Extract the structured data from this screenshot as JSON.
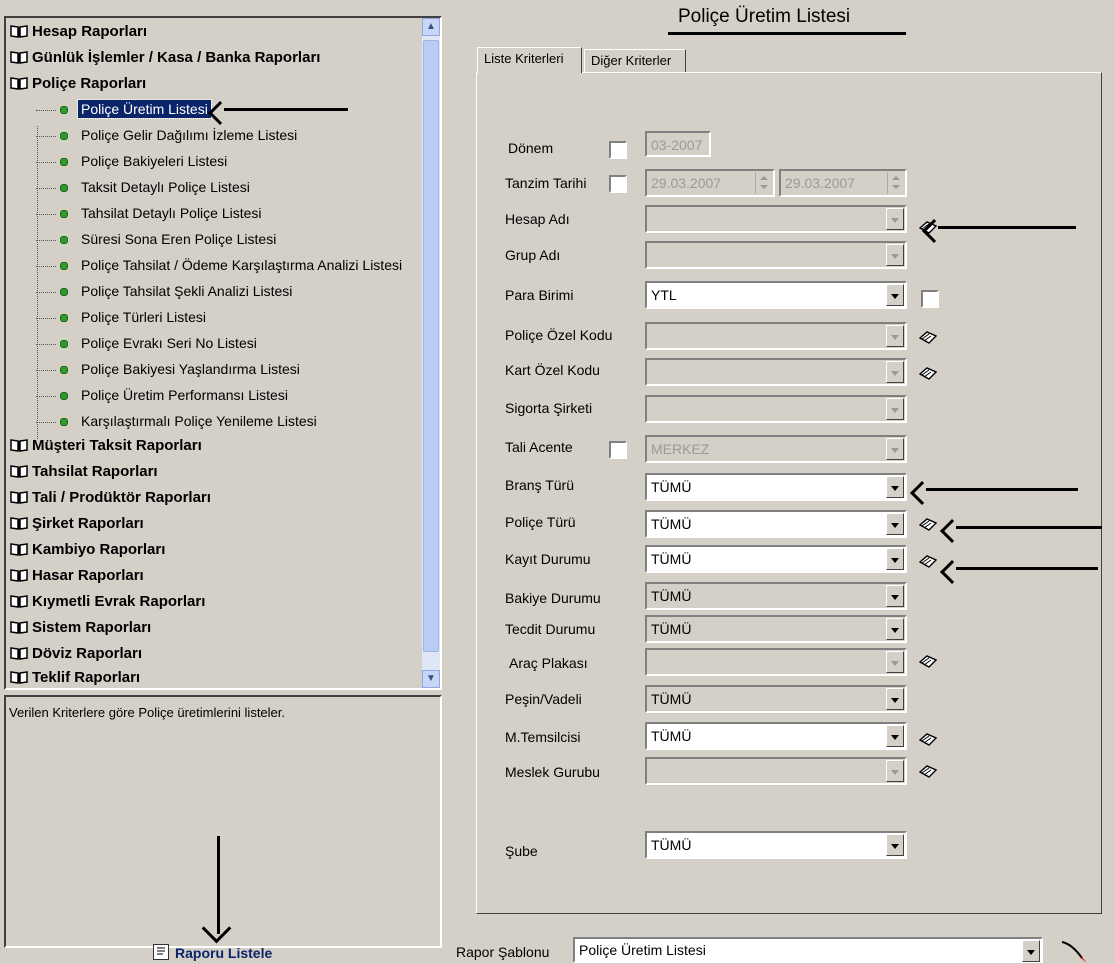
{
  "tree": {
    "groups_top": [
      {
        "label": "Hesap Raporları"
      },
      {
        "label": "Günlük İşlemler / Kasa / Banka Raporları"
      },
      {
        "label": "Poliçe Raporları"
      }
    ],
    "items": [
      {
        "label": "Poliçe Üretim Listesi",
        "selected": true
      },
      {
        "label": "Poliçe Gelir Dağılımı İzleme Listesi"
      },
      {
        "label": "Poliçe Bakiyeleri Listesi"
      },
      {
        "label": "Taksit Detaylı Poliçe Listesi"
      },
      {
        "label": "Tahsilat Detaylı Poliçe Listesi"
      },
      {
        "label": "Süresi Sona Eren Poliçe Listesi"
      },
      {
        "label": "Poliçe Tahsilat / Ödeme Karşılaştırma Analizi Listesi"
      },
      {
        "label": "Poliçe Tahsilat Şekli Analizi Listesi"
      },
      {
        "label": "Poliçe Türleri Listesi"
      },
      {
        "label": "Poliçe Evrakı Seri No Listesi"
      },
      {
        "label": "Poliçe Bakiyesi Yaşlandırma Listesi"
      },
      {
        "label": "Poliçe Üretim Performansı Listesi"
      },
      {
        "label": "Karşılaştırmalı Poliçe Yenileme Listesi"
      }
    ],
    "groups_bottom": [
      {
        "label": "Müşteri Taksit Raporları"
      },
      {
        "label": "Tahsilat Raporları"
      },
      {
        "label": "Tali / Prodüktör Raporları"
      },
      {
        "label": "Şirket Raporları"
      },
      {
        "label": "Kambiyo Raporları"
      },
      {
        "label": "Hasar Raporları"
      },
      {
        "label": "Kıymetli Evrak Raporları"
      },
      {
        "label": "Sistem Raporları"
      },
      {
        "label": "Döviz Raporları"
      },
      {
        "label": "Teklif Raporları"
      }
    ]
  },
  "description": "Verilen Kriterlere göre Poliçe üretimlerini listeler.",
  "report_button": "Raporu Listele",
  "title": "Poliçe Üretim Listesi",
  "tabs": [
    "Liste Kriterleri",
    "Diğer Kriterler"
  ],
  "form": {
    "donem": {
      "label": "Dönem",
      "value": "03-2007"
    },
    "tanzim": {
      "label": "Tanzim Tarihi",
      "from": "29.03.2007",
      "to": "29.03.2007"
    },
    "hesap_adi": {
      "label": "Hesap Adı"
    },
    "grup_adi": {
      "label": "Grup Adı"
    },
    "para_birimi": {
      "label": "Para Birimi",
      "value": "YTL"
    },
    "police_ozel_kodu": {
      "label": "Poliçe Özel Kodu"
    },
    "kart_ozel_kodu": {
      "label": "Kart Özel Kodu"
    },
    "sigorta_sirketi": {
      "label": "Sigorta Şirketi"
    },
    "tali_acente": {
      "label": "Tali Acente",
      "value": "MERKEZ"
    },
    "brans_turu": {
      "label": "Branş Türü",
      "value": "TÜMÜ"
    },
    "police_turu": {
      "label": "Poliçe Türü",
      "value": "TÜMÜ"
    },
    "kayit_durumu": {
      "label": "Kayıt Durumu",
      "value": "TÜMÜ"
    },
    "bakiye_durumu": {
      "label": "Bakiye Durumu",
      "value": "TÜMÜ"
    },
    "tecdit_durumu": {
      "label": "Tecdit Durumu",
      "value": "TÜMÜ"
    },
    "arac_plakasi": {
      "label": "Araç Plakası"
    },
    "pesin_vadeli": {
      "label": "Peşin/Vadeli",
      "value": "TÜMÜ"
    },
    "m_temsilcisi": {
      "label": "M.Temsilcisi",
      "value": "TÜMÜ"
    },
    "meslek_gurubu": {
      "label": "Meslek Gurubu"
    },
    "sube": {
      "label": "Şube",
      "value": "TÜMÜ"
    }
  },
  "sablon": {
    "label": "Rapor Şablonu",
    "value": "Poliçe Üretim Listesi"
  },
  "colors": {
    "selection": "#0a246a",
    "background": "#d4d0c8",
    "leaf_dot": "#2e9a2e",
    "scroll": "#c9d6f5"
  }
}
